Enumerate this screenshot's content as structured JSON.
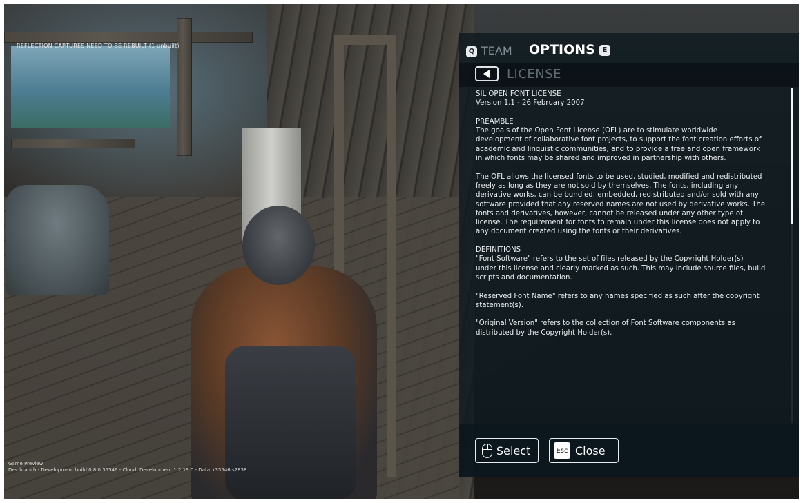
{
  "debug": {
    "top_warning": "REFLECTION CAPTURES NEED TO BE REBUILT (1 unbuilt)",
    "bottom_line1": "Game Preview",
    "bottom_line2": "Dev branch - Development build 0.8.0.35546 - Cloud: Development 1.2.19.0 - Data: r35546 s2838"
  },
  "tabs": {
    "team": {
      "key": "Q",
      "label": "TEAM"
    },
    "options": {
      "key": "E",
      "label": "OPTIONS"
    }
  },
  "license": {
    "title": "LICENSE",
    "heading1": "SIL OPEN FONT LICENSE",
    "heading2": "Version 1.1 - 26 February 2007",
    "preamble_title": "PREAMBLE",
    "preamble_p1": "The goals of the Open Font License (OFL) are to stimulate worldwide development of collaborative font projects, to support the font creation efforts of academic and linguistic communities, and to provide a free and open framework in which fonts may be shared and improved in partnership with others.",
    "preamble_p2": "The OFL allows the licensed fonts to be used, studied, modified and redistributed freely as long as they are not sold by themselves. The fonts, including any derivative works, can be bundled, embedded, redistributed and/or sold with any software provided that any reserved names are not used by derivative works. The fonts and derivatives, however, cannot be released under any other type of license. The requirement for fonts to remain under this license does not apply to any document created using the fonts or their derivatives.",
    "definitions_title": "DEFINITIONS",
    "def_p1": "\"Font Software\" refers to the set of files released by the Copyright Holder(s) under this license and clearly marked as such. This may include source files, build scripts and documentation.",
    "def_p2": "\"Reserved Font Name\" refers to any names specified as such after the copyright statement(s).",
    "def_p3": "\"Original Version\" refers to the collection of Font Software components as distributed by the Copyright Holder(s)."
  },
  "footer": {
    "select_label": "Select",
    "close_key": "Esc",
    "close_label": "Close"
  }
}
